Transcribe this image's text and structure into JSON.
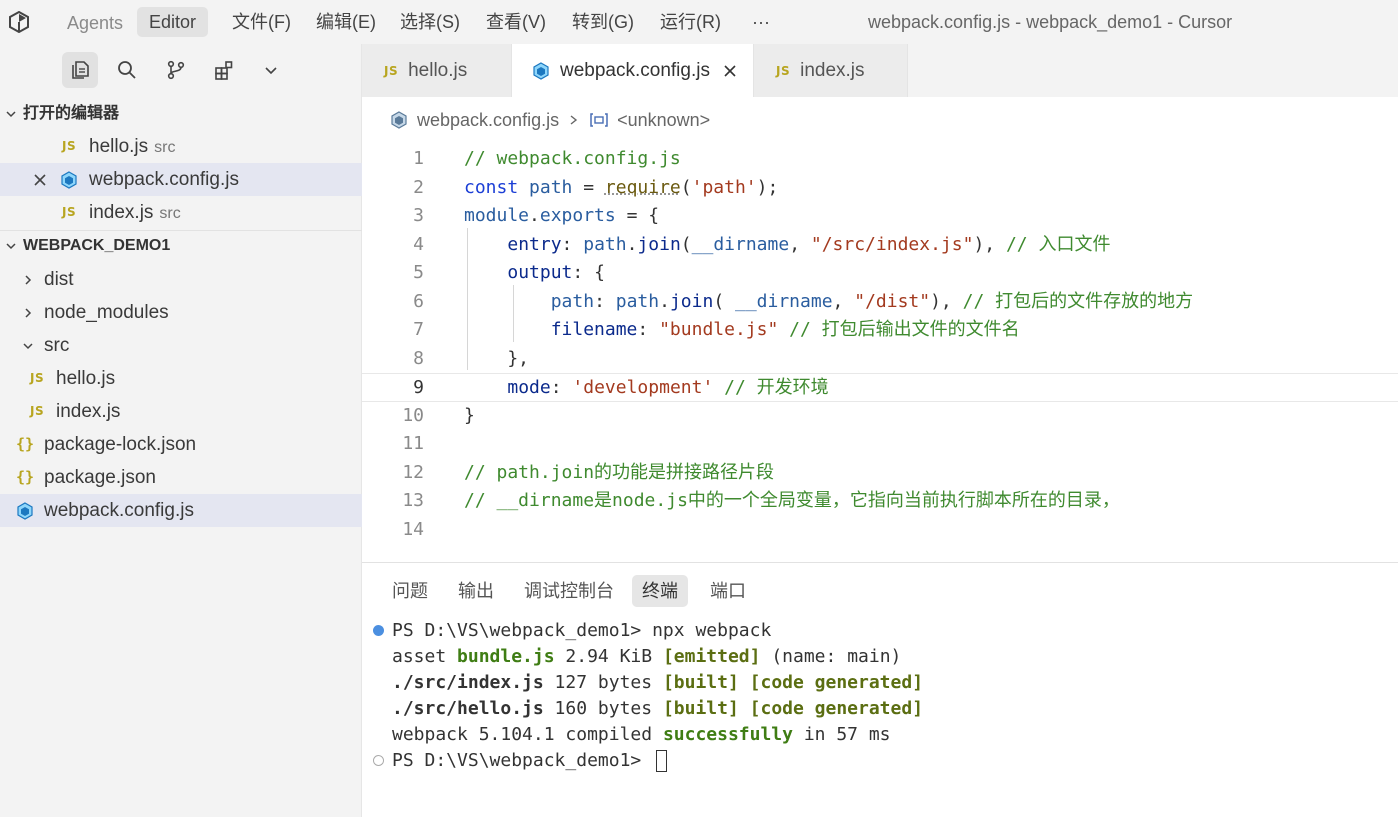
{
  "titlebar": {
    "agents": "Agents",
    "editor": "Editor",
    "menu": [
      "文件(F)",
      "编辑(E)",
      "选择(S)",
      "查看(V)",
      "转到(G)",
      "运行(R)",
      "···"
    ],
    "window_title": "webpack.config.js - webpack_demo1 - Cursor"
  },
  "sidebar": {
    "toolbar_icons": [
      "explorer-icon",
      "search-icon",
      "source-control-icon",
      "extensions-icon",
      "chevron-down-icon"
    ],
    "open_editors": {
      "title": "打开的编辑器",
      "items": [
        {
          "name": "hello.js",
          "dir": "src",
          "icon": "js"
        },
        {
          "name": "webpack.config.js",
          "dir": "",
          "icon": "webpack"
        },
        {
          "name": "index.js",
          "dir": "src",
          "icon": "js"
        }
      ]
    },
    "project": {
      "title": "WEBPACK_DEMO1",
      "items": [
        {
          "name": "dist",
          "type": "folder-collapsed"
        },
        {
          "name": "node_modules",
          "type": "folder-collapsed"
        },
        {
          "name": "src",
          "type": "folder-expanded"
        },
        {
          "name": "hello.js",
          "type": "js"
        },
        {
          "name": "index.js",
          "type": "js"
        },
        {
          "name": "package-lock.json",
          "type": "json"
        },
        {
          "name": "package.json",
          "type": "json"
        },
        {
          "name": "webpack.config.js",
          "type": "webpack"
        }
      ]
    },
    "js_badge": "JS",
    "json_badge": "{}"
  },
  "tabs": [
    {
      "label": "hello.js",
      "icon": "js"
    },
    {
      "label": "webpack.config.js",
      "icon": "webpack",
      "active": true
    },
    {
      "label": "index.js",
      "icon": "js"
    }
  ],
  "breadcrumb": {
    "file": "webpack.config.js",
    "symbol": "<unknown>"
  },
  "editor": {
    "line_numbers": [
      "1",
      "2",
      "3",
      "4",
      "5",
      "6",
      "7",
      "8",
      "9",
      "10",
      "11",
      "12",
      "13",
      "14"
    ],
    "current_line": 9,
    "lines": [
      "// webpack.config.js",
      "const path = require('path');",
      "module.exports = {",
      "    entry: path.join(__dirname, \"/src/index.js\"), // 入口文件",
      "    output: {",
      "        path: path.join( __dirname, \"/dist\"), // 打包后的文件存放的地方",
      "        filename: \"bundle.js\" // 打包后输出文件的文件名",
      "    },",
      "    mode: 'development' // 开发环境",
      "}",
      "",
      "// path.join的功能是拼接路径片段",
      "// __dirname是node.js中的一个全局变量，它指向当前执行脚本所在的目录，",
      ""
    ]
  },
  "panel": {
    "tabs": [
      "问题",
      "输出",
      "调试控制台",
      "终端",
      "端口"
    ],
    "active_tab": "终端",
    "terminal": {
      "prompt": "PS D:\\VS\\webpack_demo1> ",
      "command": "npx webpack",
      "asset_prefix": "asset ",
      "asset_name": "bundle.js",
      "asset_size": " 2.94 KiB ",
      "asset_flag": "[emitted]",
      "asset_suffix": " (name: main)",
      "mod1_name": "./src/index.js",
      "mod1_size": " 127 bytes ",
      "mod2_name": "./src/hello.js",
      "mod2_size": " 160 bytes ",
      "built": "[built]",
      "codegen": "[code generated]",
      "compiled_prefix": "webpack 5.104.1 compiled ",
      "compiled_status": "successfully",
      "compiled_suffix": " in 57 ms"
    }
  }
}
